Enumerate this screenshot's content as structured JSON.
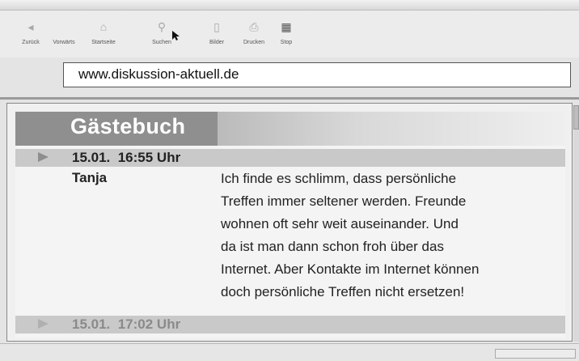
{
  "toolbar": {
    "buttons": [
      {
        "label": "Zurück",
        "icon": "back-icon"
      },
      {
        "label": "Vorwärts",
        "icon": "forward-icon"
      },
      {
        "label": "Startseite",
        "icon": "home-icon"
      },
      {
        "label": "Suchen",
        "icon": "search-icon"
      },
      {
        "label": "Bilder",
        "icon": "images-icon"
      },
      {
        "label": "Drucken",
        "icon": "print-icon"
      },
      {
        "label": "Stop",
        "icon": "stop-icon"
      }
    ]
  },
  "address_bar": {
    "url": "www.diskussion-aktuell.de"
  },
  "page": {
    "title": "Gästebuch",
    "entries": [
      {
        "datetime": "15.01.  16:55 Uhr",
        "author": "Tanja",
        "message_lines": [
          "Ich finde es schlimm, dass persönliche",
          "Treffen immer seltener werden. Freunde",
          "wohnen oft sehr weit auseinander. Und",
          "da ist man dann schon froh über das",
          "Internet. Aber Kontakte im Internet können",
          "doch persönliche Treffen nicht ersetzen!"
        ]
      },
      {
        "datetime": "15.01.  17:02 Uhr"
      }
    ]
  },
  "colors": {
    "header_bg": "#8f8f8f",
    "entry_bar_bg": "#c9c9c9",
    "title_text": "#ffffff"
  }
}
